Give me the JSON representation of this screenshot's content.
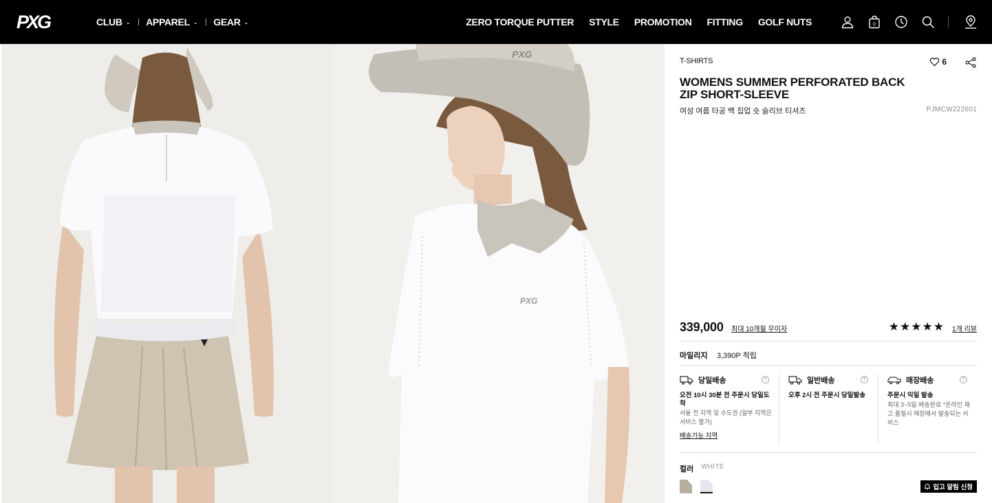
{
  "brand": {
    "logo_text": "PXG"
  },
  "nav": {
    "primary": [
      {
        "label": "CLUB"
      },
      {
        "label": "APPAREL"
      },
      {
        "label": "GEAR"
      }
    ],
    "secondary": [
      "ZERO TORQUE PUTTER",
      "STYLE",
      "PROMOTION",
      "FITTING",
      "GOLF NUTS"
    ],
    "icons": [
      "user-icon",
      "bag-icon",
      "history-icon",
      "search-icon",
      "store-location-icon"
    ]
  },
  "product": {
    "category": "T-SHIRTS",
    "likes": "6",
    "title": "WOMENS SUMMER PERFORATED BACK ZIP SHORT-SLEEVE",
    "title_ko": "여성 여름 타공 백 집업 숏 슬리브 티셔츠",
    "sku": "PJMCW222601",
    "price": "339,000",
    "installment": "최대 10개월 무이자",
    "stars": "★★★★★",
    "rating_stars": 5,
    "reviews": "1개 리뷰",
    "mileage_label": "마일리지",
    "mileage_value": "3,390P 적립"
  },
  "delivery": [
    {
      "title": "당일배송",
      "bold": "오전 10시 30분 전 주문시 당일도착",
      "sub": "서울 전 지역 및 수도권 (일부 지역은 서비스 불가)",
      "link": "배송가능 지역"
    },
    {
      "title": "일반배송",
      "bold": "오후 2시 전 주문시 당일발송"
    },
    {
      "title": "매장배송",
      "bold": "주문시 익일 발송",
      "sub": "최대 3~5일 배송완료 *온라인 재고 품절시 매장에서 발송되는 서비스"
    }
  ],
  "color": {
    "label": "컬러",
    "selected": "WHITE",
    "swatches": [
      "#b8ae9f",
      "#e6e6ee"
    ]
  },
  "restock_button": "입고 알림 신청",
  "colors": {
    "header_bg": "#000000",
    "accent": "#111111"
  }
}
